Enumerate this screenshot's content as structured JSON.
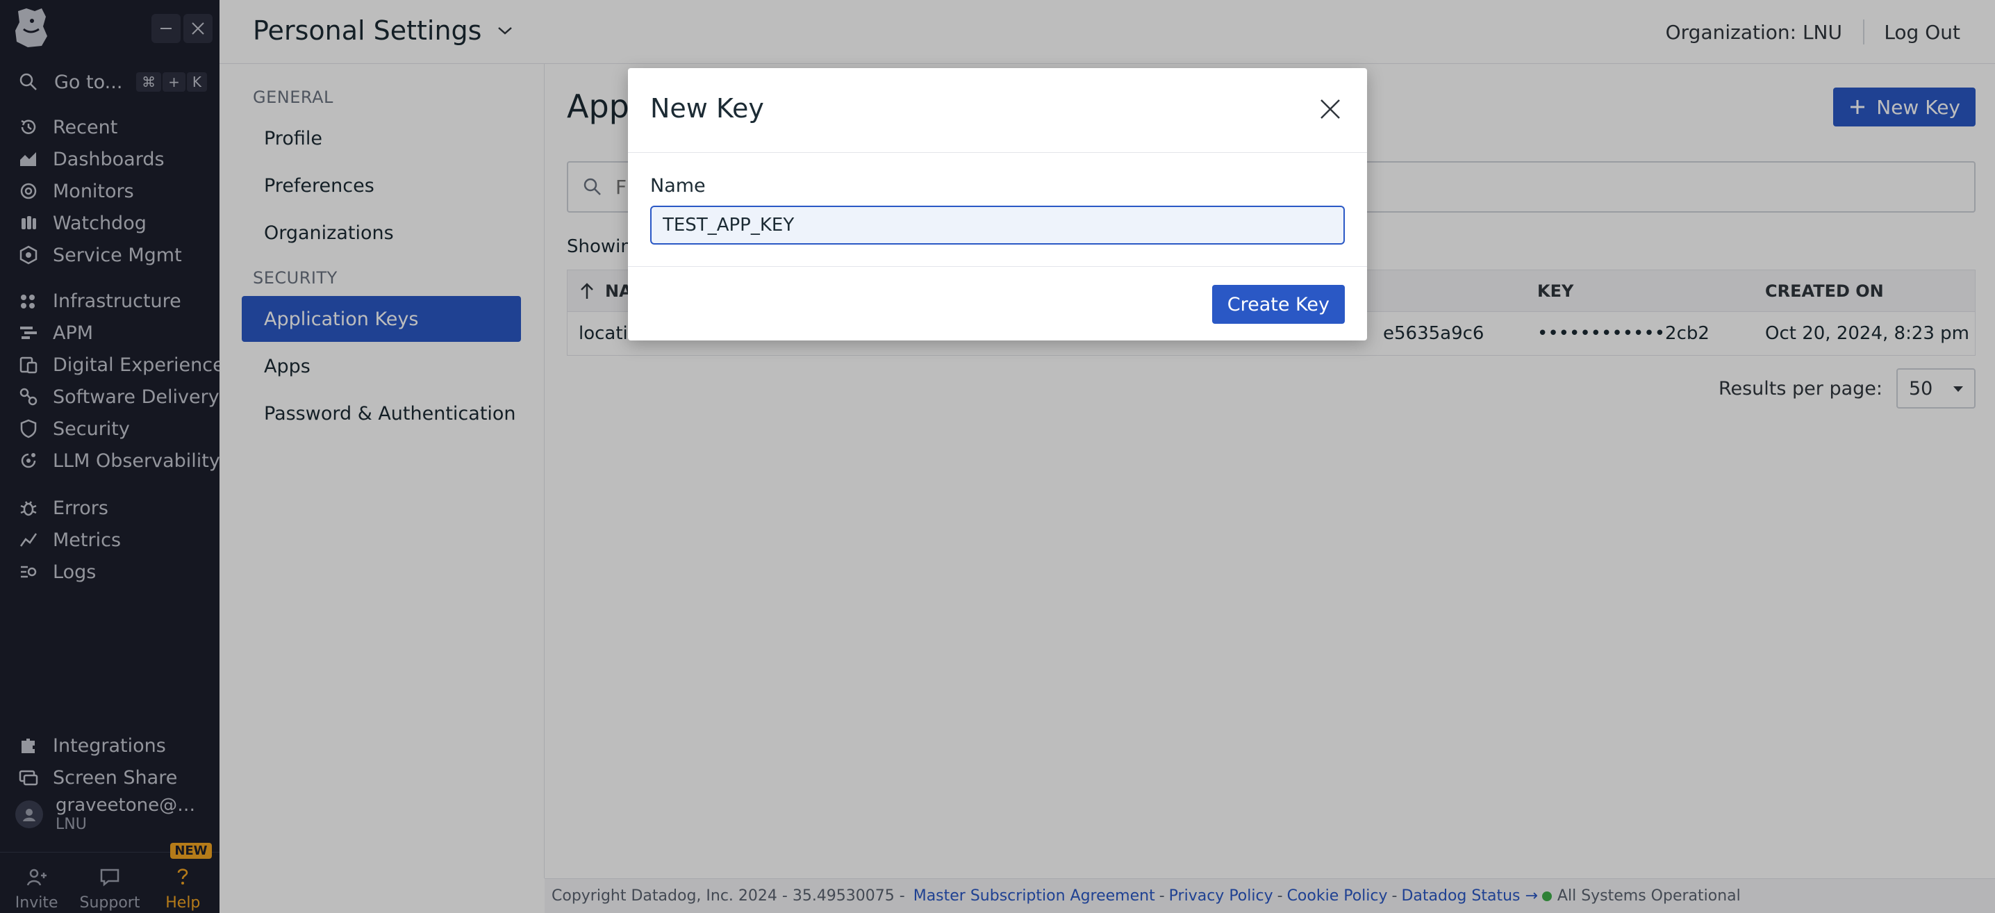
{
  "nav": {
    "goto_label": "Go to...",
    "shortcut_keys": [
      "⌘",
      "+",
      "K"
    ],
    "items": [
      {
        "label": "Recent",
        "icon": "history-icon"
      },
      {
        "label": "Dashboards",
        "icon": "dashboards-icon"
      },
      {
        "label": "Monitors",
        "icon": "monitors-icon"
      },
      {
        "label": "Watchdog",
        "icon": "watchdog-icon"
      },
      {
        "label": "Service Mgmt",
        "icon": "service-mgmt-icon"
      },
      {
        "label": "Infrastructure",
        "icon": "infrastructure-icon"
      },
      {
        "label": "APM",
        "icon": "apm-icon"
      },
      {
        "label": "Digital Experience",
        "icon": "digital-experience-icon"
      },
      {
        "label": "Software Delivery",
        "icon": "software-delivery-icon"
      },
      {
        "label": "Security",
        "icon": "security-icon"
      },
      {
        "label": "LLM Observability",
        "icon": "llm-observability-icon"
      },
      {
        "label": "Errors",
        "icon": "errors-icon"
      },
      {
        "label": "Metrics",
        "icon": "metrics-icon"
      },
      {
        "label": "Logs",
        "icon": "logs-icon"
      },
      {
        "label": "Integrations",
        "icon": "integrations-icon"
      },
      {
        "label": "Screen Share",
        "icon": "screen-share-icon"
      }
    ],
    "user": {
      "name": "graveetone@g...",
      "org": "LNU"
    },
    "bottom": {
      "invite": "Invite",
      "support": "Support",
      "help": "Help",
      "new_badge": "NEW"
    }
  },
  "header": {
    "title": "Personal Settings",
    "organization": "Organization: LNU",
    "logout": "Log Out"
  },
  "subnav": {
    "general_heading": "GENERAL",
    "security_heading": "SECURITY",
    "items": [
      "Profile",
      "Preferences",
      "Organizations",
      "Application Keys",
      "Apps",
      "Password & Authentication"
    ],
    "active": "Application Keys"
  },
  "main": {
    "title_visible": "App",
    "new_key_button": "New Key",
    "filter_placeholder": "F",
    "showing_visible": "Showin",
    "table": {
      "headers": {
        "name": "NA",
        "key": "KEY",
        "created_on": "CREATED ON"
      },
      "rows": [
        {
          "name": "locatio",
          "key_id": "e5635a9c6",
          "key": "••••••••••••2cb2",
          "created_on": "Oct 20, 2024, 8:23 pm"
        }
      ]
    },
    "results_per_page_label": "Results per page:",
    "results_per_page_value": "50"
  },
  "footer": {
    "copyright": "Copyright Datadog, Inc. 2024 - 35.49530075 -",
    "links": [
      "Master Subscription Agreement",
      "Privacy Policy",
      "Cookie Policy",
      "Datadog Status →"
    ],
    "status": "All Systems Operational"
  },
  "modal": {
    "title": "New Key",
    "name_label": "Name",
    "name_value": "TEST_APP_KEY",
    "create_button": "Create Key"
  },
  "colors": {
    "primary": "#2a58c5",
    "nav_bg": "#1d1f2d",
    "help_accent": "#f5a623",
    "status_ok": "#3fae49"
  }
}
